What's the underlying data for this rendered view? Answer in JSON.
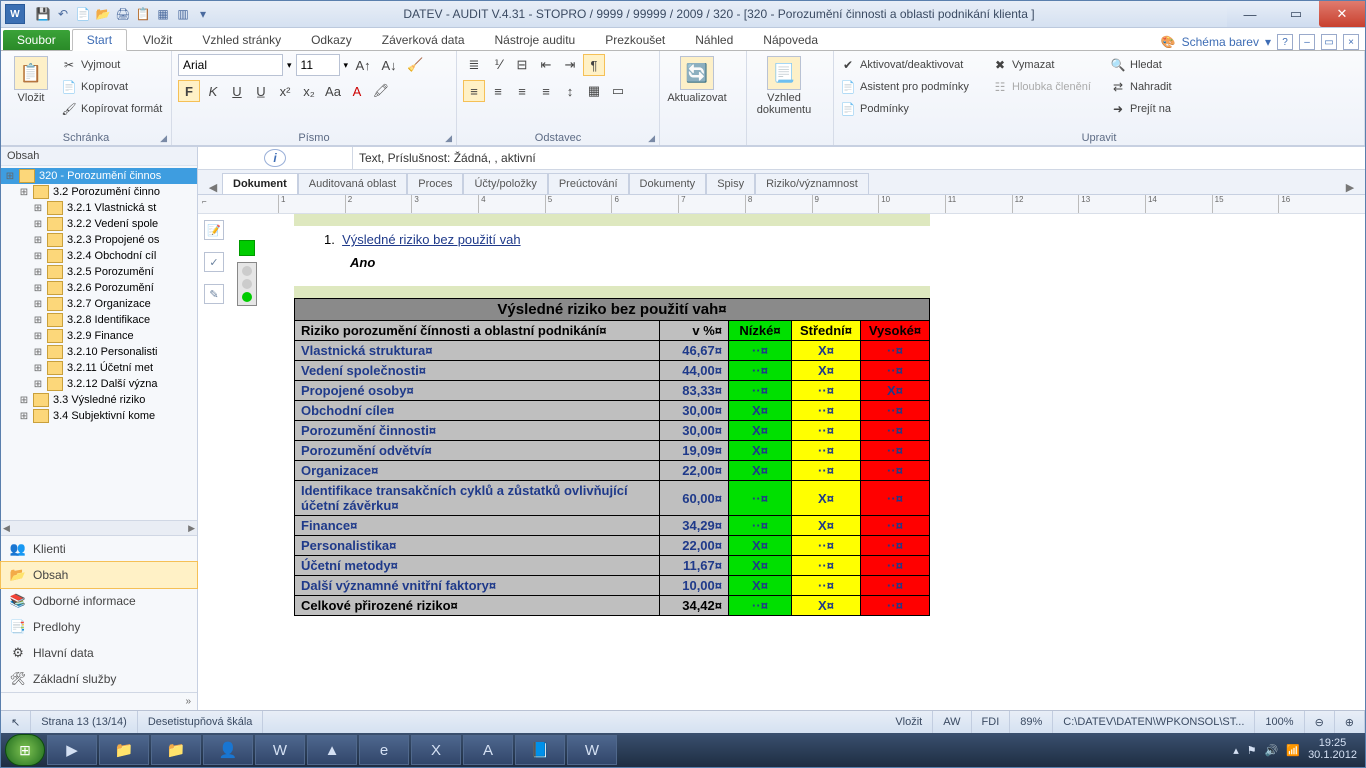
{
  "title": "DATEV - AUDIT V.4.31 - STOPRO / 9999 / 99999 / 2009 / 320  - [320 - Porozumění činnosti a oblasti podnikání klienta ]",
  "ribbon": {
    "file": "Soubor",
    "tabs": [
      "Start",
      "Vložit",
      "Vzhled stránky",
      "Odkazy",
      "Záverková data",
      "Nástroje auditu",
      "Prezkoušet",
      "Náhled",
      "Nápoveda"
    ],
    "scheme": "Schéma barev",
    "groups": {
      "schranka": {
        "label": "Schránka",
        "paste": "Vložit",
        "cut": "Vyjmout",
        "copy": "Kopírovat",
        "fmt": "Kopírovat formát"
      },
      "pismo": {
        "label": "Písmo",
        "font": "Arial",
        "size": "11"
      },
      "odstavec": {
        "label": "Odstavec"
      },
      "aktualizovat": "Aktualizovat",
      "vzhled": "Vzhled dokumentu",
      "upravit": {
        "label": "Upravit",
        "act": "Aktivovat/deaktivovat",
        "asist": "Asistent pro podmínky",
        "pod": "Podmínky",
        "vym": "Vymazat",
        "hloub": "Hloubka členění",
        "hledat": "Hledat",
        "nahradit": "Nahradit",
        "prejit": "Prejít na"
      }
    }
  },
  "left": {
    "header": "Obsah",
    "nodes": [
      {
        "lvl": 0,
        "txt": "320 - Porozumění činnos",
        "sel": true
      },
      {
        "lvl": 1,
        "txt": "3.2 Porozumění činno"
      },
      {
        "lvl": 2,
        "txt": "3.2.1 Vlastnická st"
      },
      {
        "lvl": 2,
        "txt": "3.2.2 Vedení spole"
      },
      {
        "lvl": 2,
        "txt": "3.2.3 Propojené os"
      },
      {
        "lvl": 2,
        "txt": "3.2.4 Obchodní cíl"
      },
      {
        "lvl": 2,
        "txt": "3.2.5 Porozumění"
      },
      {
        "lvl": 2,
        "txt": "3.2.6 Porozumění"
      },
      {
        "lvl": 2,
        "txt": "3.2.7 Organizace"
      },
      {
        "lvl": 2,
        "txt": "3.2.8 Identifikace"
      },
      {
        "lvl": 2,
        "txt": "3.2.9 Finance"
      },
      {
        "lvl": 2,
        "txt": "3.2.10 Personalisti"
      },
      {
        "lvl": 2,
        "txt": "3.2.11 Účetní met"
      },
      {
        "lvl": 2,
        "txt": "3.2.12 Další význa"
      },
      {
        "lvl": 1,
        "txt": "3.3 Výsledné riziko"
      },
      {
        "lvl": 1,
        "txt": "3.4 Subjektivní kome"
      }
    ],
    "nav": [
      {
        "lbl": "Klienti",
        "ico": "👥"
      },
      {
        "lbl": "Obsah",
        "ico": "📂",
        "sel": true
      },
      {
        "lbl": "Odborné informace",
        "ico": "📚"
      },
      {
        "lbl": "Predlohy",
        "ico": "📑"
      },
      {
        "lbl": "Hlavní data",
        "ico": "⚙"
      },
      {
        "lbl": "Základní služby",
        "ico": "🛠"
      }
    ]
  },
  "info_text": "Text, Príslušnost: Žádná, , aktivní",
  "doc_tabs": [
    "Dokument",
    "Auditovaná oblast",
    "Proces",
    "Účty/položky",
    "Preúctování",
    "Dokumenty",
    "Spisy",
    "Riziko/významnost"
  ],
  "doc": {
    "list_num": "1.",
    "list_link": "Výsledné riziko bez použití vah",
    "ano": "Ano",
    "table": {
      "title": "Výsledné riziko bez použití vah¤",
      "h1": "Riziko porozumění čínnosti a oblastní podnikání¤",
      "h2": "v %¤",
      "h3": "Nízké¤",
      "h4": "Střední¤",
      "h5": "Vysoké¤",
      "rows": [
        {
          "lbl": "Vlastnická struktura¤",
          "pct": "46,67¤",
          "low": "··¤",
          "mid": "X¤",
          "hi": "··¤"
        },
        {
          "lbl": "Vedení společnosti¤",
          "pct": "44,00¤",
          "low": "··¤",
          "mid": "X¤",
          "hi": "··¤"
        },
        {
          "lbl": "Propojené osoby¤",
          "pct": "83,33¤",
          "low": "··¤",
          "mid": "··¤",
          "hi": "X¤"
        },
        {
          "lbl": "Obchodní cíle¤",
          "pct": "30,00¤",
          "low": "X¤",
          "mid": "··¤",
          "hi": "··¤"
        },
        {
          "lbl": "Porozumění činnosti¤",
          "pct": "30,00¤",
          "low": "X¤",
          "mid": "··¤",
          "hi": "··¤"
        },
        {
          "lbl": "Porozumění odvětví¤",
          "pct": "19,09¤",
          "low": "X¤",
          "mid": "··¤",
          "hi": "··¤"
        },
        {
          "lbl": "Organizace¤",
          "pct": "22,00¤",
          "low": "X¤",
          "mid": "··¤",
          "hi": "··¤"
        },
        {
          "lbl": "Identifikace transakčních cyklů a zůstatků ovlivňující účetní závěrku¤",
          "pct": "60,00¤",
          "low": "··¤",
          "mid": "X¤",
          "hi": "··¤"
        },
        {
          "lbl": "Finance¤",
          "pct": "34,29¤",
          "low": "··¤",
          "mid": "X¤",
          "hi": "··¤"
        },
        {
          "lbl": "Personalistika¤",
          "pct": "22,00¤",
          "low": "X¤",
          "mid": "··¤",
          "hi": "··¤"
        },
        {
          "lbl": "Účetní metody¤",
          "pct": "11,67¤",
          "low": "X¤",
          "mid": "··¤",
          "hi": "··¤"
        },
        {
          "lbl": "Další významné vnitřní faktory¤",
          "pct": "10,00¤",
          "low": "X¤",
          "mid": "··¤",
          "hi": "··¤"
        }
      ],
      "total": {
        "lbl": "Celkové přirozené riziko¤",
        "pct": "34,42¤",
        "low": "··¤",
        "mid": "X¤",
        "hi": "··¤"
      }
    }
  },
  "status": {
    "page": "Strana 13 (13/14)",
    "scale": "Desetistupňová škála",
    "vlozit": "Vložit",
    "aw": "AW",
    "fdi": "FDI",
    "zoom1": "89%",
    "path": "C:\\DATEV\\DATEN\\WPKONSOL\\ST...",
    "zoom2": "100%"
  },
  "clock": {
    "time": "19:25",
    "date": "30.1.2012"
  }
}
